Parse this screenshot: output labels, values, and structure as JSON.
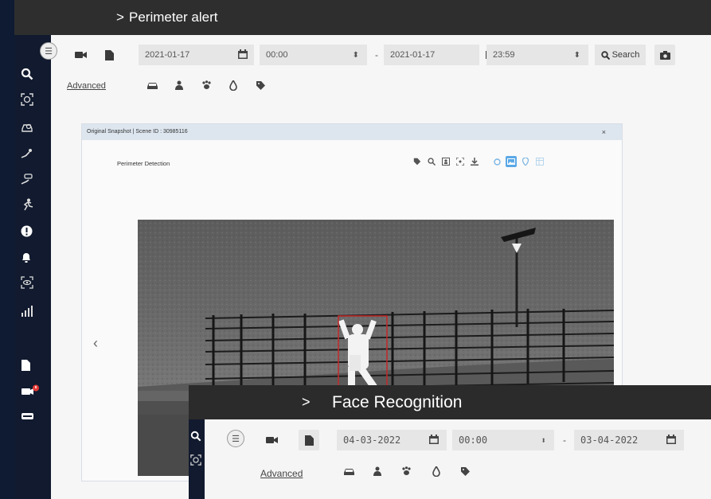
{
  "main_window": {
    "title": "Perimeter alert",
    "chevron": ">"
  },
  "sidebar": {
    "icons": [
      "search-icon",
      "face-scan-icon",
      "car-search-icon",
      "person-trail-icon",
      "vehicle-trail-icon",
      "perimeter-runner-icon",
      "alert-icon",
      "bell-icon",
      "eye-icon",
      "stats-icon",
      "document-icon",
      "camera-alert-icon",
      "card-icon"
    ]
  },
  "toolbar": {
    "start_date": "2021-01-17",
    "start_time": "00:00",
    "separator": "-",
    "end_date": "2021-01-17",
    "end_time": "23:59",
    "search_label": "Search",
    "advanced_label": "Advanced"
  },
  "snapshot": {
    "header": "Original Snapshot | Scene ID : 30985116",
    "close": "×",
    "subtitle": "Perimeter Detection",
    "prev": "‹",
    "next": "›"
  },
  "face_window": {
    "title": "Face Recognition",
    "chevron": ">",
    "start_date": "04-03-2022",
    "start_time": "00:00",
    "separator": "-",
    "end_date": "03-04-2022",
    "advanced_label": "Advanced"
  },
  "colors": {
    "background": "#0f1a33",
    "titlebar": "#2e2e2e",
    "sidebar": "#111a2e",
    "alert_red": "#e53935",
    "detection_box": "#c62828",
    "accent_blue": "#5aa8e6"
  }
}
